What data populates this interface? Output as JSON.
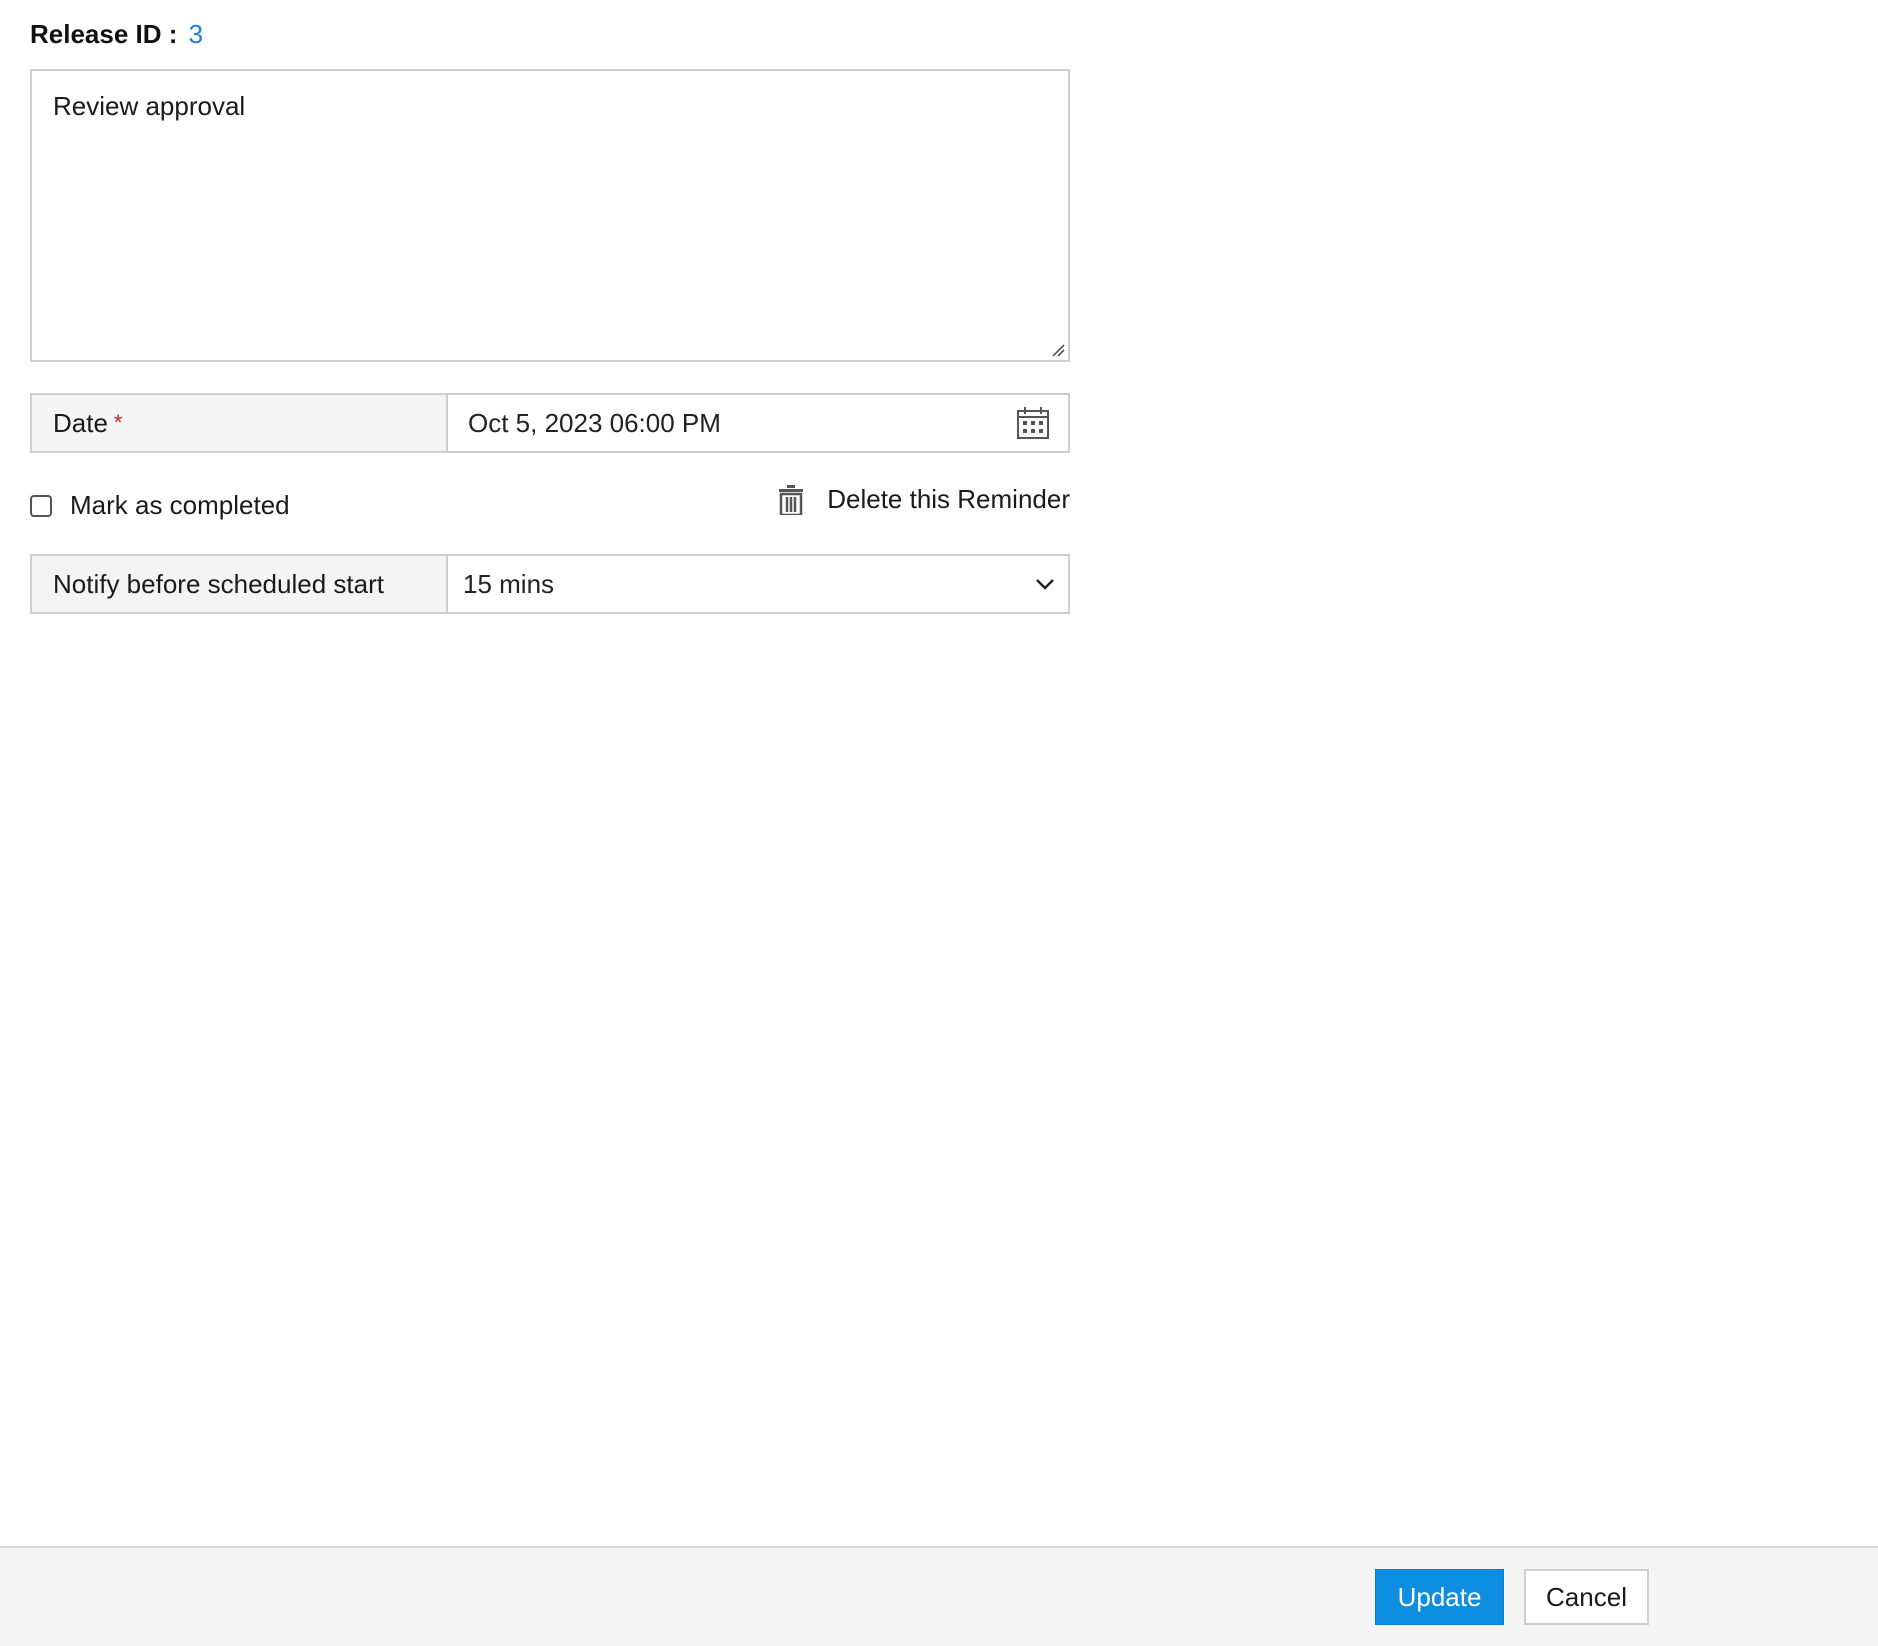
{
  "release": {
    "label": "Release ID :",
    "value": "3"
  },
  "notes": {
    "value": "Review approval"
  },
  "date_field": {
    "label": "Date",
    "required_mark": "*",
    "value": "Oct 5, 2023 06:00 PM",
    "icon": "calendar-icon"
  },
  "completed": {
    "label": "Mark as completed",
    "checked": false
  },
  "delete": {
    "label": "Delete this Reminder",
    "icon": "trash-icon"
  },
  "notify_field": {
    "label": "Notify before scheduled start",
    "value": "15 mins",
    "icon": "chevron-down-icon"
  },
  "footer": {
    "update_label": "Update",
    "cancel_label": "Cancel"
  },
  "colors": {
    "accent": "#0d8ee0",
    "link": "#1a7fd4",
    "required": "#d42020"
  }
}
